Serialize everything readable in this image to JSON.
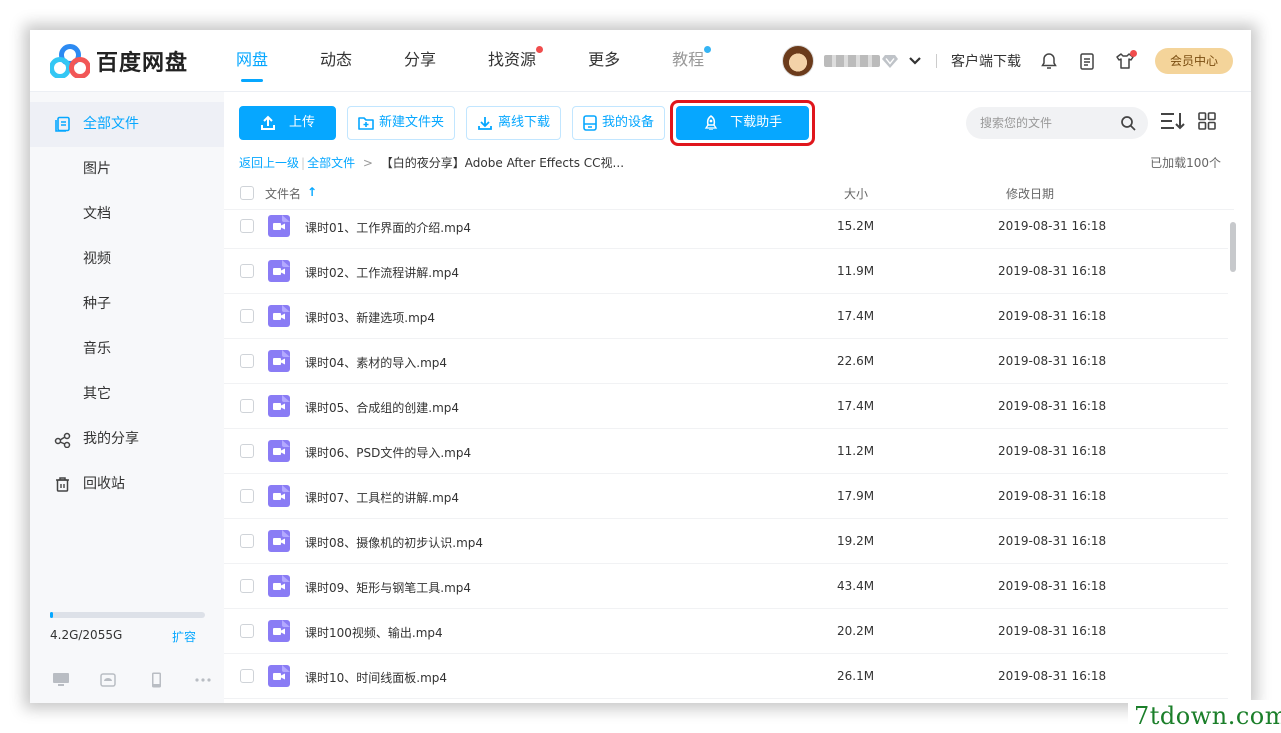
{
  "app": {
    "brand_name": "百度网盘",
    "colors": {
      "accent": "#06a7ff",
      "highlight_box": "#e0161c",
      "nav_dot_red": "#f04d4d",
      "nav_dot_blue": "#06a7ff",
      "member_bg": "#f4d49a"
    }
  },
  "nav": {
    "items": [
      {
        "label": "网盘",
        "state": "active"
      },
      {
        "label": "动态"
      },
      {
        "label": "分享"
      },
      {
        "label": "找资源",
        "dot": "red"
      },
      {
        "label": "更多"
      },
      {
        "label": "教程",
        "dot": "blue",
        "state": "muted"
      }
    ]
  },
  "header_right": {
    "client_download": "客户端下载",
    "member_center": "会员中心",
    "icons": [
      "bell-icon",
      "clipboard-icon",
      "shirt-icon"
    ]
  },
  "sidebar": {
    "items": [
      {
        "label": "全部文件",
        "icon": "files-icon",
        "active": true
      },
      {
        "label": "图片"
      },
      {
        "label": "文档"
      },
      {
        "label": "视频"
      },
      {
        "label": "种子"
      },
      {
        "label": "音乐"
      },
      {
        "label": "其它"
      },
      {
        "label": "我的分享",
        "icon": "share-icon"
      },
      {
        "label": "回收站",
        "icon": "trash-icon"
      }
    ],
    "quota_text": "4.2G/2055G",
    "quota_fraction": 0.002,
    "expand_label": "扩容",
    "devices": [
      "desktop-icon",
      "android-icon",
      "phone-icon",
      "more-icon"
    ]
  },
  "toolbar": {
    "upload": "上传",
    "new_folder": "新建文件夹",
    "offline_download": "离线下载",
    "my_devices": "我的设备",
    "download_helper": "下载助手"
  },
  "search": {
    "placeholder": "搜索您的文件"
  },
  "breadcrumb": {
    "back": "返回上一级",
    "all_files": "全部文件",
    "arrow": ">",
    "current": "【白的夜分享】Adobe After Effects CC视..."
  },
  "loaded_count": "已加载100个",
  "table": {
    "headers": {
      "name": "文件名",
      "size": "大小",
      "date": "修改日期"
    },
    "rows": [
      {
        "name": "课时01、工作界面的介绍.mp4",
        "size": "15.2M",
        "date": "2019-08-31 16:18"
      },
      {
        "name": "课时02、工作流程讲解.mp4",
        "size": "11.9M",
        "date": "2019-08-31 16:18"
      },
      {
        "name": "课时03、新建选项.mp4",
        "size": "17.4M",
        "date": "2019-08-31 16:18"
      },
      {
        "name": "课时04、素材的导入.mp4",
        "size": "22.6M",
        "date": "2019-08-31 16:18"
      },
      {
        "name": "课时05、合成组的创建.mp4",
        "size": "17.4M",
        "date": "2019-08-31 16:18"
      },
      {
        "name": "课时06、PSD文件的导入.mp4",
        "size": "11.2M",
        "date": "2019-08-31 16:18"
      },
      {
        "name": "课时07、工具栏的讲解.mp4",
        "size": "17.9M",
        "date": "2019-08-31 16:18"
      },
      {
        "name": "课时08、摄像机的初步认识.mp4",
        "size": "19.2M",
        "date": "2019-08-31 16:18"
      },
      {
        "name": "课时09、矩形与钢笔工具.mp4",
        "size": "43.4M",
        "date": "2019-08-31 16:18"
      },
      {
        "name": "课时100视频、输出.mp4",
        "size": "20.2M",
        "date": "2019-08-31 16:18"
      },
      {
        "name": "课时10、时间线面板.mp4",
        "size": "26.1M",
        "date": "2019-08-31 16:18"
      }
    ]
  },
  "watermark": "7tdown.com"
}
